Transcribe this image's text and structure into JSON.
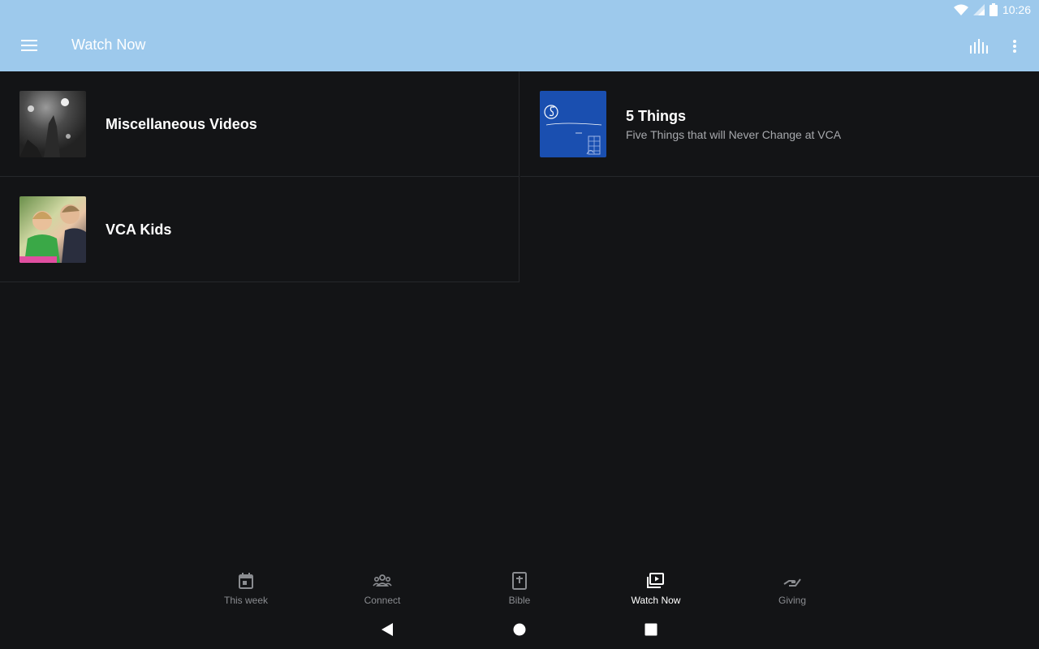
{
  "status_bar": {
    "time": "10:26"
  },
  "app_bar": {
    "title": "Watch Now",
    "menu_icon": "menu-icon",
    "audio_icon": "equalizer-icon",
    "more_icon": "more-vert-icon",
    "background": "#9dc9ec"
  },
  "items": [
    {
      "title": "Miscellaneous Videos",
      "subtitle": ""
    },
    {
      "title": "5 Things",
      "subtitle": "Five Things that will Never Change at VCA"
    },
    {
      "title": "VCA Kids",
      "subtitle": ""
    }
  ],
  "bottom_nav": [
    {
      "label": "This week",
      "icon": "calendar-icon",
      "active": false
    },
    {
      "label": "Connect",
      "icon": "group-icon",
      "active": false
    },
    {
      "label": "Bible",
      "icon": "bible-icon",
      "active": false
    },
    {
      "label": "Watch Now",
      "icon": "video-library-icon",
      "active": true
    },
    {
      "label": "Giving",
      "icon": "giving-hand-icon",
      "active": false
    }
  ],
  "system_nav": {
    "back": "back-icon",
    "home": "home-icon",
    "recents": "recents-icon"
  }
}
